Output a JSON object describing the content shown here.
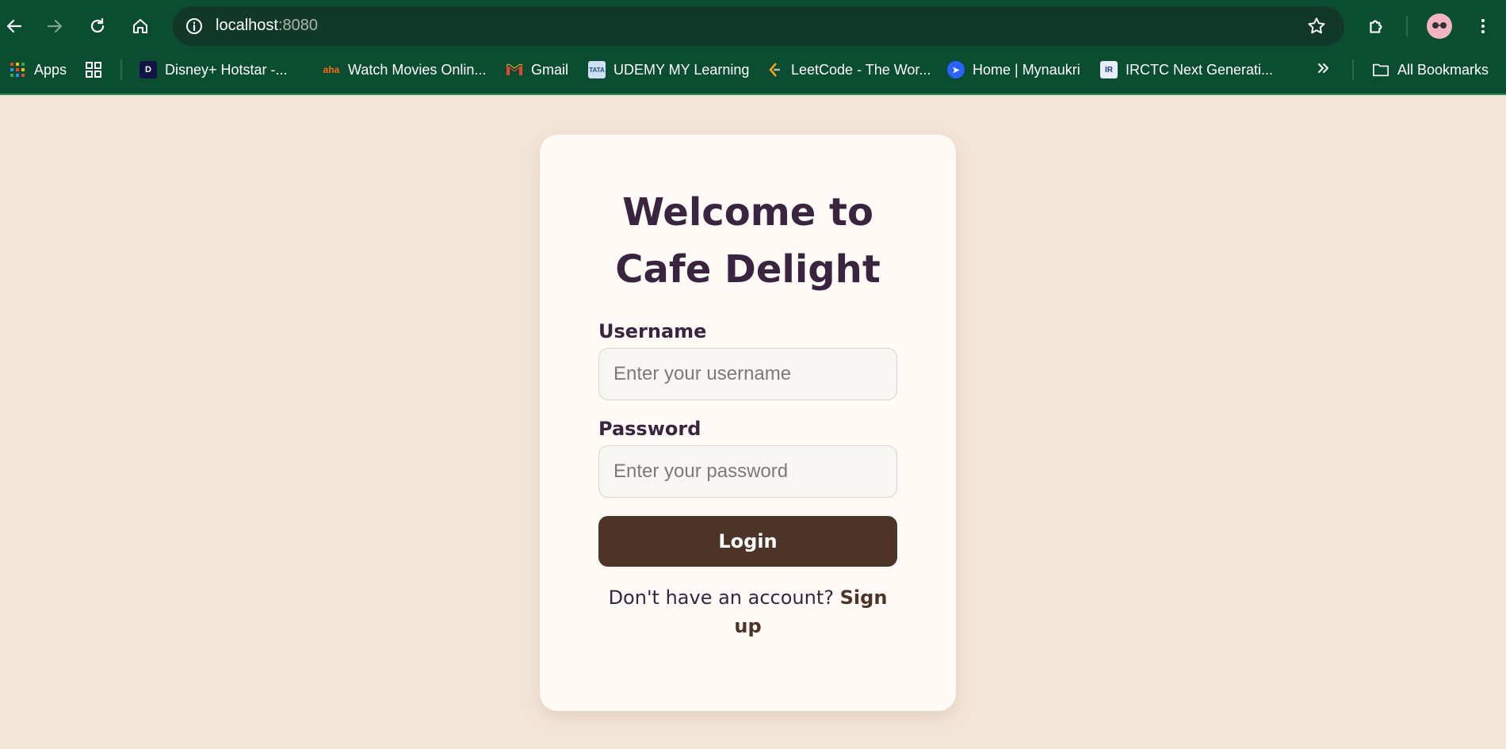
{
  "browser": {
    "url_host": "localhost",
    "url_port": ":8080",
    "bookmarks": [
      {
        "label": "Apps",
        "icon": "apps-grid-icon"
      },
      {
        "label": "",
        "icon": "tab-groups-icon"
      },
      {
        "label": "Disney+ Hotstar -...",
        "icon": "hotstar-icon"
      },
      {
        "label": "Watch Movies Onlin...",
        "icon": "aha-icon"
      },
      {
        "label": "Gmail",
        "icon": "gmail-icon"
      },
      {
        "label": "UDEMY MY Learning",
        "icon": "tata-icon"
      },
      {
        "label": "LeetCode - The Wor...",
        "icon": "leetcode-icon"
      },
      {
        "label": "Home | Mynaukri",
        "icon": "mynaukri-icon"
      },
      {
        "label": "IRCTC Next Generati...",
        "icon": "irctc-icon"
      }
    ],
    "all_bookmarks_label": "All Bookmarks"
  },
  "login": {
    "title_line1": "Welcome to",
    "title_line2": "Cafe Delight",
    "username_label": "Username",
    "username_placeholder": "Enter your username",
    "username_value": "",
    "password_label": "Password",
    "password_placeholder": "Enter your password",
    "password_value": "",
    "login_button": "Login",
    "signup_prompt": "Don't have an account?",
    "signup_link": "Sign up"
  },
  "colors": {
    "page_bg": "#f4e6d7",
    "card_bg": "#fffaf6",
    "title": "#3a2540",
    "button": "#4d3426",
    "chrome": "#0a4d30"
  }
}
